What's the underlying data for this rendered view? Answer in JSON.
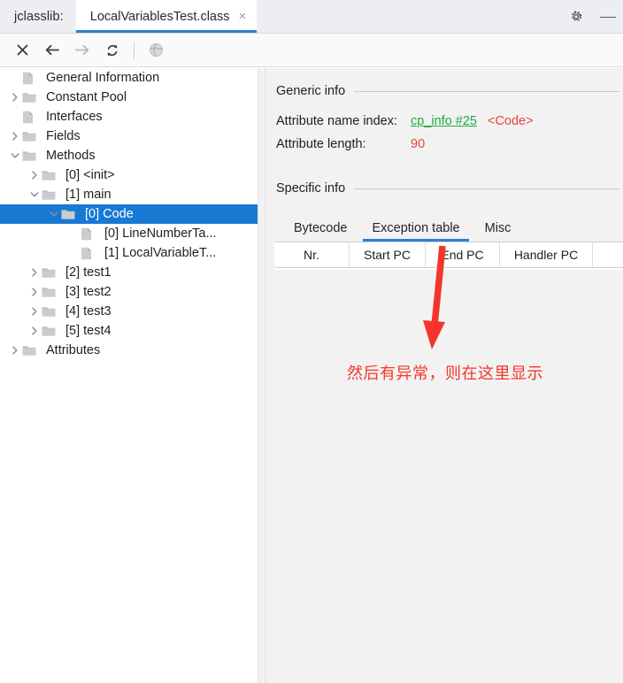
{
  "window": {
    "app_label": "jclasslib:",
    "tab": {
      "title": "LocalVariablesTest.class",
      "close_glyph": "×"
    },
    "gear_icon_name": "gear-icon",
    "minimize_label": "—"
  },
  "toolbar": {
    "buttons": [
      {
        "name": "close-file-button",
        "glyph": "×",
        "enabled": true
      },
      {
        "name": "back-button",
        "glyph": "←",
        "enabled": true
      },
      {
        "name": "forward-button",
        "glyph": "→",
        "enabled": false
      },
      {
        "name": "reload-button",
        "glyph": "↻",
        "enabled": true
      },
      {
        "name": "browse-class-path-button",
        "glyph": "●",
        "enabled": false
      }
    ]
  },
  "tree": {
    "nodes": [
      {
        "label": "General Information",
        "indent": 0,
        "twisty": "none",
        "icon": "file-icon",
        "selected": false
      },
      {
        "label": "Constant Pool",
        "indent": 0,
        "twisty": "collapsed",
        "icon": "folder-icon",
        "selected": false
      },
      {
        "label": "Interfaces",
        "indent": 0,
        "twisty": "none",
        "icon": "file-icon",
        "selected": false
      },
      {
        "label": "Fields",
        "indent": 0,
        "twisty": "collapsed",
        "icon": "folder-icon",
        "selected": false
      },
      {
        "label": "Methods",
        "indent": 0,
        "twisty": "expanded",
        "icon": "folder-icon",
        "selected": false
      },
      {
        "label": "[0] <init>",
        "indent": 1,
        "twisty": "collapsed",
        "icon": "folder-icon",
        "selected": false
      },
      {
        "label": "[1] main",
        "indent": 1,
        "twisty": "expanded",
        "icon": "folder-icon",
        "selected": false
      },
      {
        "label": "[0] Code",
        "indent": 2,
        "twisty": "expanded",
        "icon": "folder-icon",
        "selected": true
      },
      {
        "label": "[0] LineNumberTa...",
        "indent": 3,
        "twisty": "none",
        "icon": "file-icon",
        "selected": false
      },
      {
        "label": "[1] LocalVariableT...",
        "indent": 3,
        "twisty": "none",
        "icon": "file-icon",
        "selected": false
      },
      {
        "label": "[2] test1",
        "indent": 1,
        "twisty": "collapsed",
        "icon": "folder-icon",
        "selected": false
      },
      {
        "label": "[3] test2",
        "indent": 1,
        "twisty": "collapsed",
        "icon": "folder-icon",
        "selected": false
      },
      {
        "label": "[4] test3",
        "indent": 1,
        "twisty": "collapsed",
        "icon": "folder-icon",
        "selected": false
      },
      {
        "label": "[5] test4",
        "indent": 1,
        "twisty": "collapsed",
        "icon": "folder-icon",
        "selected": false
      },
      {
        "label": "Attributes",
        "indent": 0,
        "twisty": "collapsed",
        "icon": "folder-icon",
        "selected": false
      }
    ]
  },
  "detail": {
    "generic_info": {
      "heading": "Generic info",
      "rows": [
        {
          "key": "Attribute name index:",
          "link": "cp_info #25",
          "red": "<Code>"
        },
        {
          "key": "Attribute length:",
          "value": "90"
        }
      ]
    },
    "specific_info": {
      "heading": "Specific info",
      "tabs": [
        {
          "label": "Bytecode",
          "active": false
        },
        {
          "label": "Exception table",
          "active": true
        },
        {
          "label": "Misc",
          "active": false
        }
      ],
      "exception_table": {
        "columns": [
          "Nr.",
          "Start PC",
          "End PC",
          "Handler PC",
          ""
        ],
        "rows": []
      }
    }
  },
  "annotation": {
    "text": "然后有异常，则在这里显示",
    "arrow_name": "red-down-arrow-annotation",
    "color": "#f5352b"
  },
  "colors": {
    "accent": "#2e7fd4",
    "selection": "#1779d3",
    "link_green": "#1aaf3e",
    "value_red": "#e8433a",
    "annotation_red": "#f5352b",
    "panel_bg": "#f2f2f2",
    "titlebar_bg": "#eceef1"
  }
}
